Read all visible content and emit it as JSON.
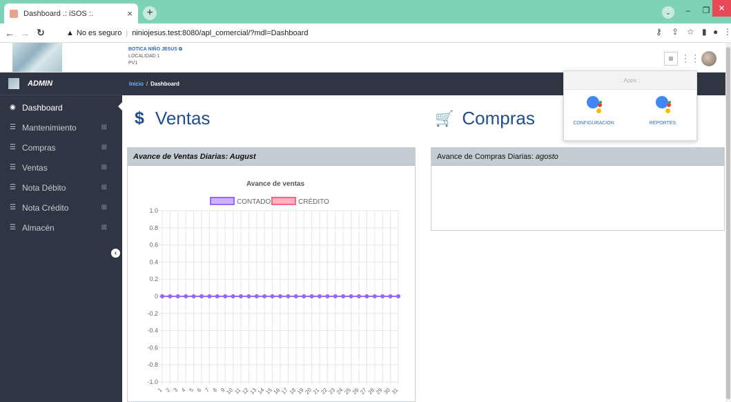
{
  "browser": {
    "tab_title": "Dashboard .: iSOS :.",
    "tab_close": "×",
    "new_tab": "+",
    "security": "No es seguro",
    "url": "niniojesus.test:8080/apl_comercial/?mdl=Dashboard"
  },
  "header": {
    "business_name": "BOTICA NIÑO JESUS",
    "location": "LOCALIDAD 1",
    "pos": "PV1"
  },
  "sidebar": {
    "user": "ADMIN",
    "items": [
      {
        "label": "Dashboard",
        "icon": "dashboard-icon"
      },
      {
        "label": "Mantenimiento",
        "icon": "list-icon"
      },
      {
        "label": "Compras",
        "icon": "list-icon"
      },
      {
        "label": "Ventas",
        "icon": "list-icon"
      },
      {
        "label": "Nota Débito",
        "icon": "list-icon"
      },
      {
        "label": "Nota Crédito",
        "icon": "list-icon"
      },
      {
        "label": "Almacén",
        "icon": "list-icon"
      }
    ]
  },
  "breadcrumb": {
    "home": "Inicio",
    "current": "Dashboard"
  },
  "ventas": {
    "title": "Ventas",
    "panel_title": "Avance de Ventas Diarias: August"
  },
  "compras": {
    "title": "Compras",
    "panel_title_prefix": "Avance de Compras Diarias:",
    "panel_title_month": "agosto"
  },
  "apps": {
    "header": ".: Apps :.",
    "items": [
      {
        "label": "CONFIGURACION"
      },
      {
        "label": "REPORTES"
      }
    ]
  },
  "chart_data": {
    "type": "line",
    "title": "Avance de ventas",
    "x": [
      1,
      2,
      3,
      4,
      5,
      6,
      7,
      8,
      9,
      10,
      11,
      12,
      13,
      14,
      15,
      16,
      17,
      18,
      19,
      20,
      21,
      22,
      23,
      24,
      25,
      26,
      27,
      28,
      29,
      30,
      31
    ],
    "series": [
      {
        "name": "CONTADO",
        "color": "#9966ff",
        "values": [
          0,
          0,
          0,
          0,
          0,
          0,
          0,
          0,
          0,
          0,
          0,
          0,
          0,
          0,
          0,
          0,
          0,
          0,
          0,
          0,
          0,
          0,
          0,
          0,
          0,
          0,
          0,
          0,
          0,
          0,
          0
        ]
      },
      {
        "name": "CRÉDITO",
        "color": "#ff6384",
        "values": [
          0,
          0,
          0,
          0,
          0,
          0,
          0,
          0,
          0,
          0,
          0,
          0,
          0,
          0,
          0,
          0,
          0,
          0,
          0,
          0,
          0,
          0,
          0,
          0,
          0,
          0,
          0,
          0,
          0,
          0,
          0
        ]
      }
    ],
    "ylim": [
      -1.0,
      1.0
    ],
    "yticks": [
      "1.0",
      "0.8",
      "0.6",
      "0.4",
      "0.2",
      "0",
      "-0.2",
      "-0.4",
      "-0.6",
      "-0.8",
      "-1.0"
    ],
    "legend": "top",
    "grid": true
  }
}
